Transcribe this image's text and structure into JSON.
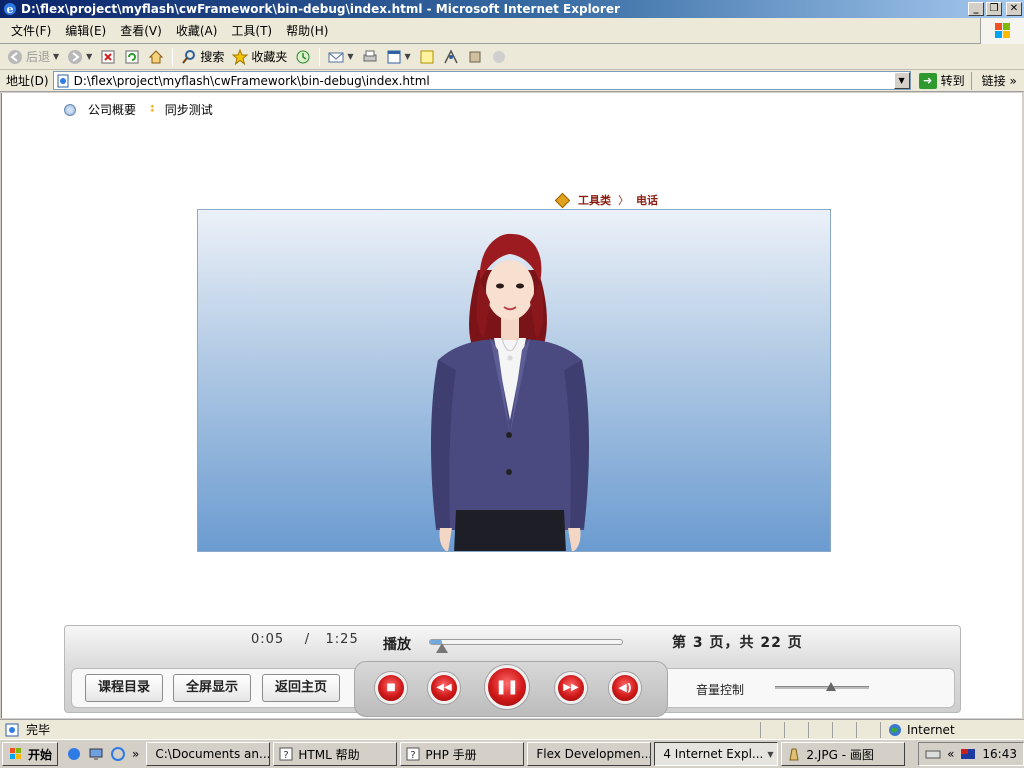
{
  "window": {
    "title": "D:\\flex\\project\\myflash\\cwFramework\\bin-debug\\index.html - Microsoft Internet Explorer"
  },
  "menu": [
    "文件(F)",
    "编辑(E)",
    "查看(V)",
    "收藏(A)",
    "工具(T)",
    "帮助(H)"
  ],
  "toolbar": {
    "back": "后退",
    "search": "搜索",
    "favorites": "收藏夹"
  },
  "address": {
    "label": "地址(D)",
    "value": "D:\\flex\\project\\myflash\\cwFramework\\bin-debug\\index.html",
    "go": "转到",
    "links": "链接"
  },
  "topnav": {
    "item1": "公司概要",
    "item2": "同步测试"
  },
  "breadcrumb": {
    "part1": "工具类",
    "sep": "〉",
    "part2": "电话"
  },
  "player": {
    "current_time": "0:05",
    "time_sep": "/",
    "total_time": "1:25",
    "play_label": "播放",
    "progress": 0.06,
    "page_info": "第 3 页，共 22 页",
    "buttons": {
      "catalog": "课程目录",
      "fullscreen": "全屏显示",
      "home": "返回主页"
    },
    "volume_label": "音量控制",
    "volume": 0.6
  },
  "status": {
    "text": "完毕",
    "zone": "Internet"
  },
  "taskbar": {
    "start": "开始",
    "tasks": [
      "C:\\Documents an...",
      "HTML 帮助",
      "PHP 手册",
      "Flex Developmen...",
      "4 Internet Expl...",
      "2.JPG - 画图"
    ],
    "clock": "16:43"
  },
  "colors": {
    "title_bar": "#0a246a",
    "stage_top": "#ecf1f8",
    "stage_bottom": "#6b9bd0",
    "control_red": "#d01818",
    "crumb": "#8a1e12"
  }
}
